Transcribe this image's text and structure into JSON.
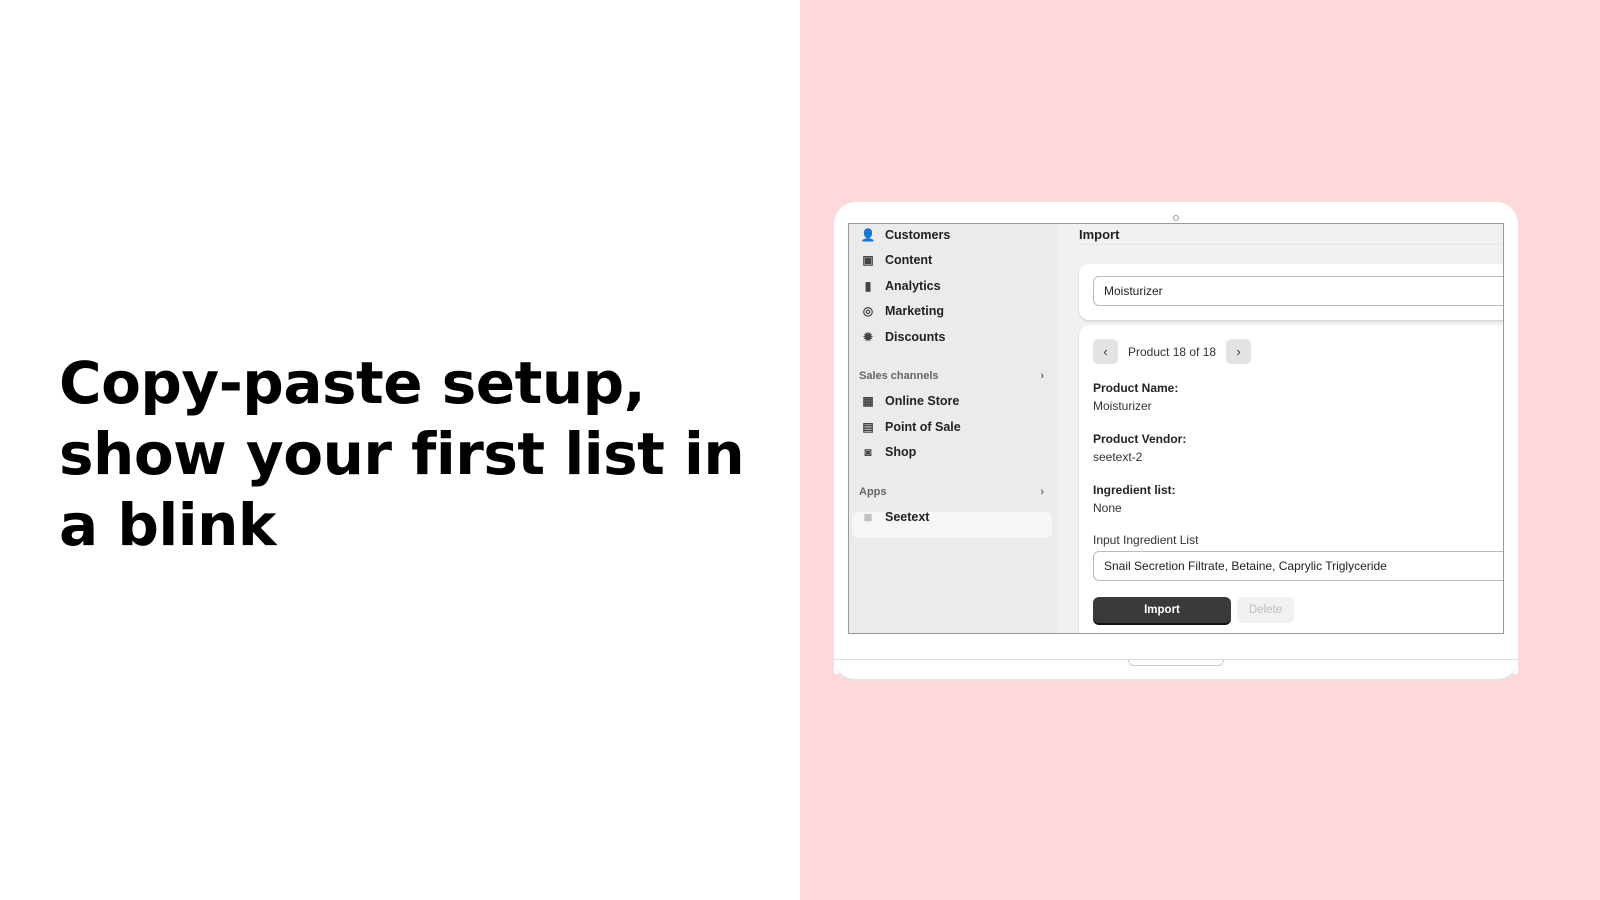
{
  "headline": "Copy-paste setup, show your first list in a blink",
  "sidebar": {
    "items": [
      {
        "label": "Customers",
        "icon": "person-icon"
      },
      {
        "label": "Content",
        "icon": "content-icon"
      },
      {
        "label": "Analytics",
        "icon": "bar-chart-icon"
      },
      {
        "label": "Marketing",
        "icon": "target-icon"
      },
      {
        "label": "Discounts",
        "icon": "discount-badge-icon"
      }
    ],
    "sales_channels_label": "Sales channels",
    "channels": [
      {
        "label": "Online Store",
        "icon": "store-icon"
      },
      {
        "label": "Point of Sale",
        "icon": "pos-icon"
      },
      {
        "label": "Shop",
        "icon": "shop-icon"
      }
    ],
    "apps_label": "Apps",
    "apps": [
      {
        "label": "Seetext",
        "icon": "app-grid-icon"
      }
    ]
  },
  "main": {
    "title": "Import",
    "search_value": "Moisturizer",
    "pager": "Product 18 of 18",
    "product_name_label": "Product Name:",
    "product_name": "Moisturizer",
    "vendor_label": "Product Vendor:",
    "vendor": "seetext-2",
    "ingredients_label": "Ingredient list:",
    "ingredients": "None",
    "input_label": "Input Ingredient List",
    "input_value": "Snail Secretion Filtrate, Betaine, Caprylic Triglyceride",
    "import_button": "Import",
    "delete_button": "Delete"
  },
  "colors": {
    "background_pink": "#fdd9dc",
    "primary_button": "#3a3a3a"
  }
}
